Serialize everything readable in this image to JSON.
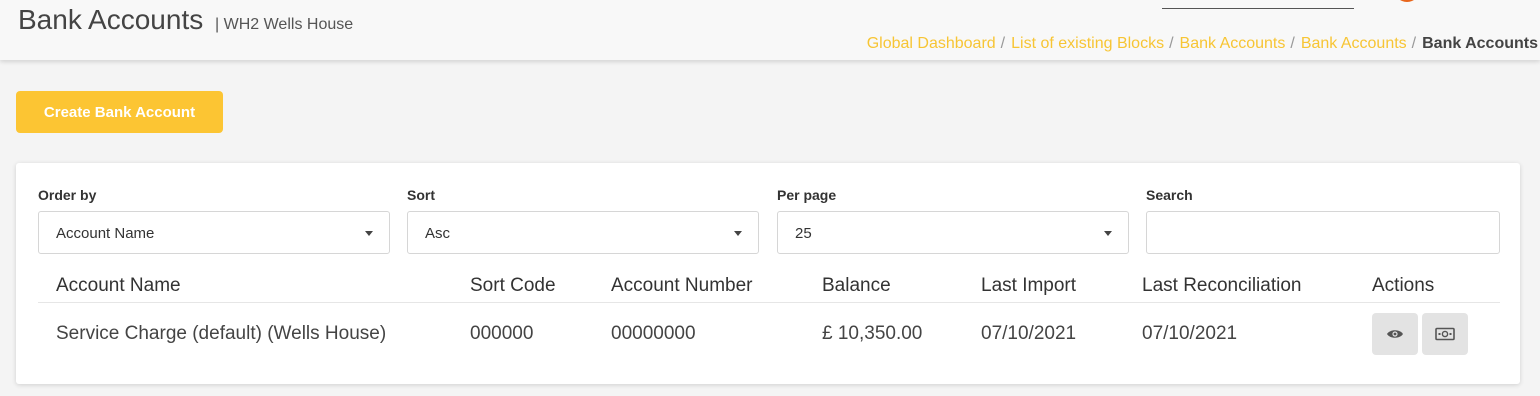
{
  "header": {
    "title": "Bank Accounts",
    "subtitle": "| WH2 Wells House",
    "breadcrumbs": [
      "Global Dashboard",
      "List of existing Blocks",
      "Bank Accounts",
      "Bank Accounts"
    ],
    "breadcrumb_separator": "/",
    "breadcrumb_current": "Bank Accounts"
  },
  "toolbar": {
    "create_label": "Create Bank Account"
  },
  "filters": {
    "order_by": {
      "label": "Order by",
      "value": "Account Name"
    },
    "sort": {
      "label": "Sort",
      "value": "Asc"
    },
    "per_page": {
      "label": "Per page",
      "value": "25"
    },
    "search": {
      "label": "Search",
      "value": ""
    }
  },
  "table": {
    "columns": [
      "Account Name",
      "Sort Code",
      "Account Number",
      "Balance",
      "Last Import",
      "Last Reconciliation",
      "Actions"
    ],
    "rows": [
      {
        "account_name": "Service Charge (default) (Wells House)",
        "sort_code": "000000",
        "account_number": "00000000",
        "balance": "£ 10,350.00",
        "last_import": "07/10/2021",
        "last_reconciliation": "07/10/2021",
        "actions": [
          "eye-icon",
          "money-icon"
        ]
      }
    ]
  },
  "colors": {
    "accent": "#fcc533",
    "breadcrumb_link": "#f7c534",
    "action_button_bg": "#e3e3e3"
  }
}
